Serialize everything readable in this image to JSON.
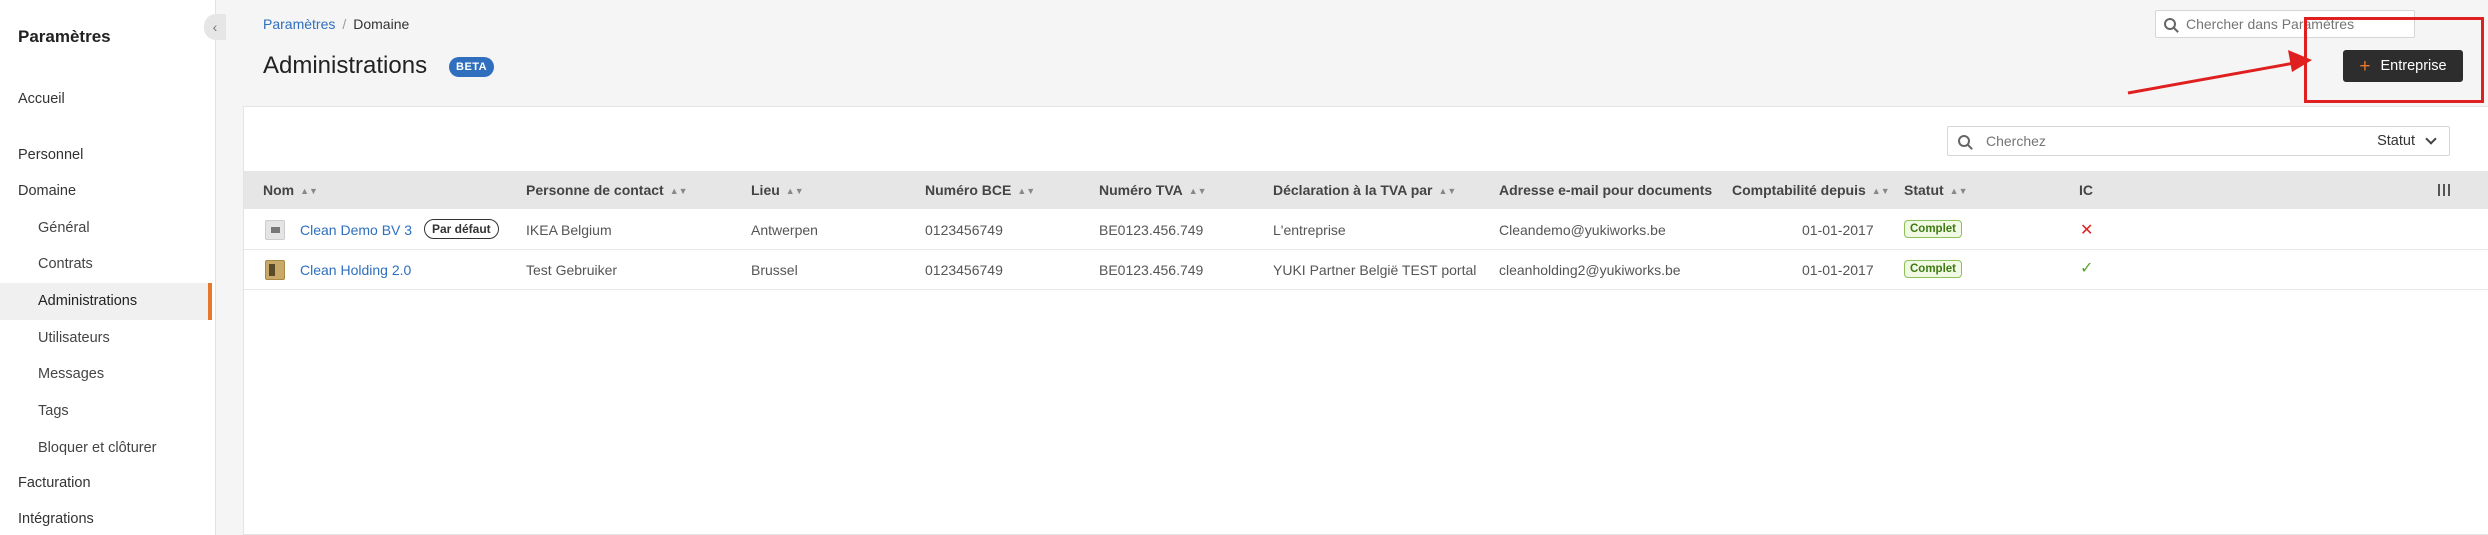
{
  "sidebar": {
    "title": "Paramètres",
    "collapse_icon": "‹",
    "items": {
      "accueil": "Accueil",
      "personnel": "Personnel",
      "domaine": "Domaine",
      "general": "Général",
      "contrats": "Contrats",
      "administrations": "Administrations",
      "utilisateurs": "Utilisateurs",
      "messages": "Messages",
      "tags": "Tags",
      "bloquer": "Bloquer et clôturer",
      "facturation": "Facturation",
      "integrations": "Intégrations"
    },
    "active": "administrations",
    "accent_color": "#e8772e"
  },
  "breadcrumb": {
    "parent": "Paramètres",
    "separator": "/",
    "current": "Domaine"
  },
  "page": {
    "title": "Administrations",
    "badge": "BETA"
  },
  "top_search": {
    "placeholder": "Chercher dans Paramètres",
    "icon": "search-icon"
  },
  "add_button": {
    "icon": "+",
    "label": "Entreprise"
  },
  "table_search": {
    "placeholder": "Cherchez",
    "status_label": "Statut"
  },
  "table": {
    "columns": {
      "nom": "Nom",
      "contact": "Personne de contact",
      "lieu": "Lieu",
      "bce": "Numéro BCE",
      "tva": "Numéro TVA",
      "declaration": "Déclaration à la TVA par",
      "email": "Adresse e-mail pour documents",
      "compta": "Comptabilité depuis",
      "statut": "Statut",
      "ic": "IC"
    },
    "sort_icon": "▲▼",
    "rows": [
      {
        "nom": "Clean Demo BV 3",
        "default_badge": "Par défaut",
        "contact": "IKEA Belgium",
        "lieu": "Antwerpen",
        "bce": "0123456749",
        "tva": "BE0123.456.749",
        "declaration": "L'entreprise",
        "email": "Cleandemo@yukiworks.be",
        "compta": "01-01-2017",
        "statut": "Complet",
        "ic": "✕"
      },
      {
        "nom": "Clean Holding 2.0",
        "contact": "Test Gebruiker",
        "lieu": "Brussel",
        "bce": "0123456749",
        "tva": "BE0123.456.749",
        "declaration": "YUKI Partner België TEST portal",
        "email": "cleanholding2@yukiworks.be",
        "compta": "01-01-2017",
        "statut": "Complet",
        "ic": "✓"
      }
    ]
  },
  "colors": {
    "link": "#2f6fbd",
    "annotation": "#e02020",
    "status_ok": "#3d7a12"
  }
}
